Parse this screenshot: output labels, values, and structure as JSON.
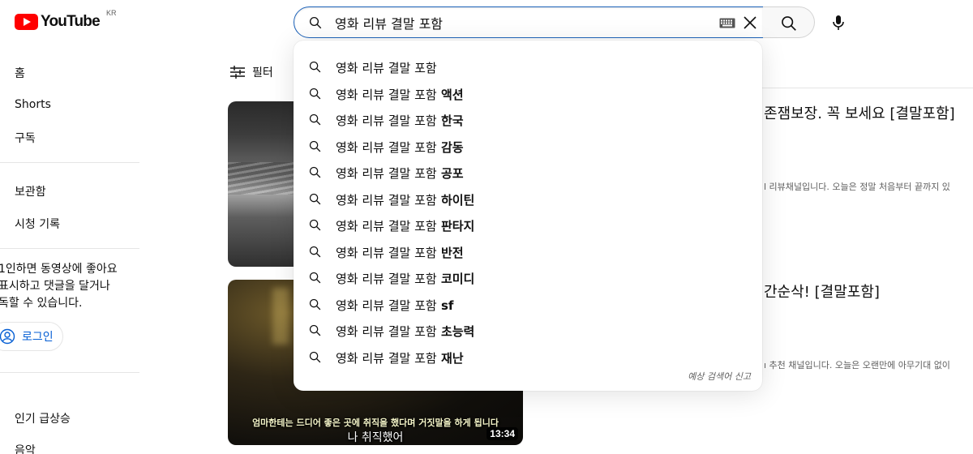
{
  "header": {
    "logo_text": "YouTube",
    "country": "KR",
    "search_value": "영화 리뷰 결말 포함",
    "search_placeholder": "검색"
  },
  "sidebar": {
    "items": [
      "홈",
      "Shorts",
      "구독",
      "보관함",
      "시청 기록"
    ],
    "login_prompt": "로그인하면 동영상에 좋아요 표시하고 댓글을 달거나 구독할 수 있습니다.",
    "login_lines": [
      "1인하면 동영상에 좋아요",
      "표시하고 댓글을 달거나",
      "독할 수 있습니다."
    ],
    "login_button": "로그인",
    "explore_items": [
      "인기 급상승",
      "음악"
    ]
  },
  "filter": {
    "label": "필터"
  },
  "videos": [
    {
      "title": "존잼보장. 꼭 보세요 [결말포함]",
      "description": "l 리뷰채널입니다. 오늘은 정말 처음부터 끝까지 있"
    },
    {
      "title": "간순삭! [결말포함]",
      "description": "ı 추천 채널입니다. 오늘은 오랜만에 아무기대 없이",
      "subtitle_small": "엄마한테는 드디어 좋은 곳에 취직을 했다며 거짓말을 하게 됩니다",
      "subtitle_big": "나 취직했어",
      "duration": "13:34"
    }
  ],
  "suggestions": [
    {
      "base": "영화 리뷰 결말 포함",
      "suffix": ""
    },
    {
      "base": "영화 리뷰 결말 포함",
      "suffix": " 액션"
    },
    {
      "base": "영화 리뷰 결말 포함",
      "suffix": " 한국"
    },
    {
      "base": "영화 리뷰 결말 포함",
      "suffix": " 감동"
    },
    {
      "base": "영화 리뷰 결말 포함",
      "suffix": " 공포"
    },
    {
      "base": "영화 리뷰 결말 포함",
      "suffix": " 하이틴"
    },
    {
      "base": "영화 리뷰 결말 포함",
      "suffix": " 판타지"
    },
    {
      "base": "영화 리뷰 결말 포함",
      "suffix": " 반전"
    },
    {
      "base": "영화 리뷰 결말 포함",
      "suffix": " 코미디"
    },
    {
      "base": "영화 리뷰 결말 포함",
      "suffix": " sf"
    },
    {
      "base": "영화 리뷰 결말 포함",
      "suffix": " 초능력"
    },
    {
      "base": "영화 리뷰 결말 포함",
      "suffix": " 재난"
    }
  ],
  "report_label": "예상 검색어 신고",
  "colors": {
    "brand_red": "#ff0000",
    "focus_blue": "#1c62b9",
    "link_blue": "#065fd4"
  }
}
